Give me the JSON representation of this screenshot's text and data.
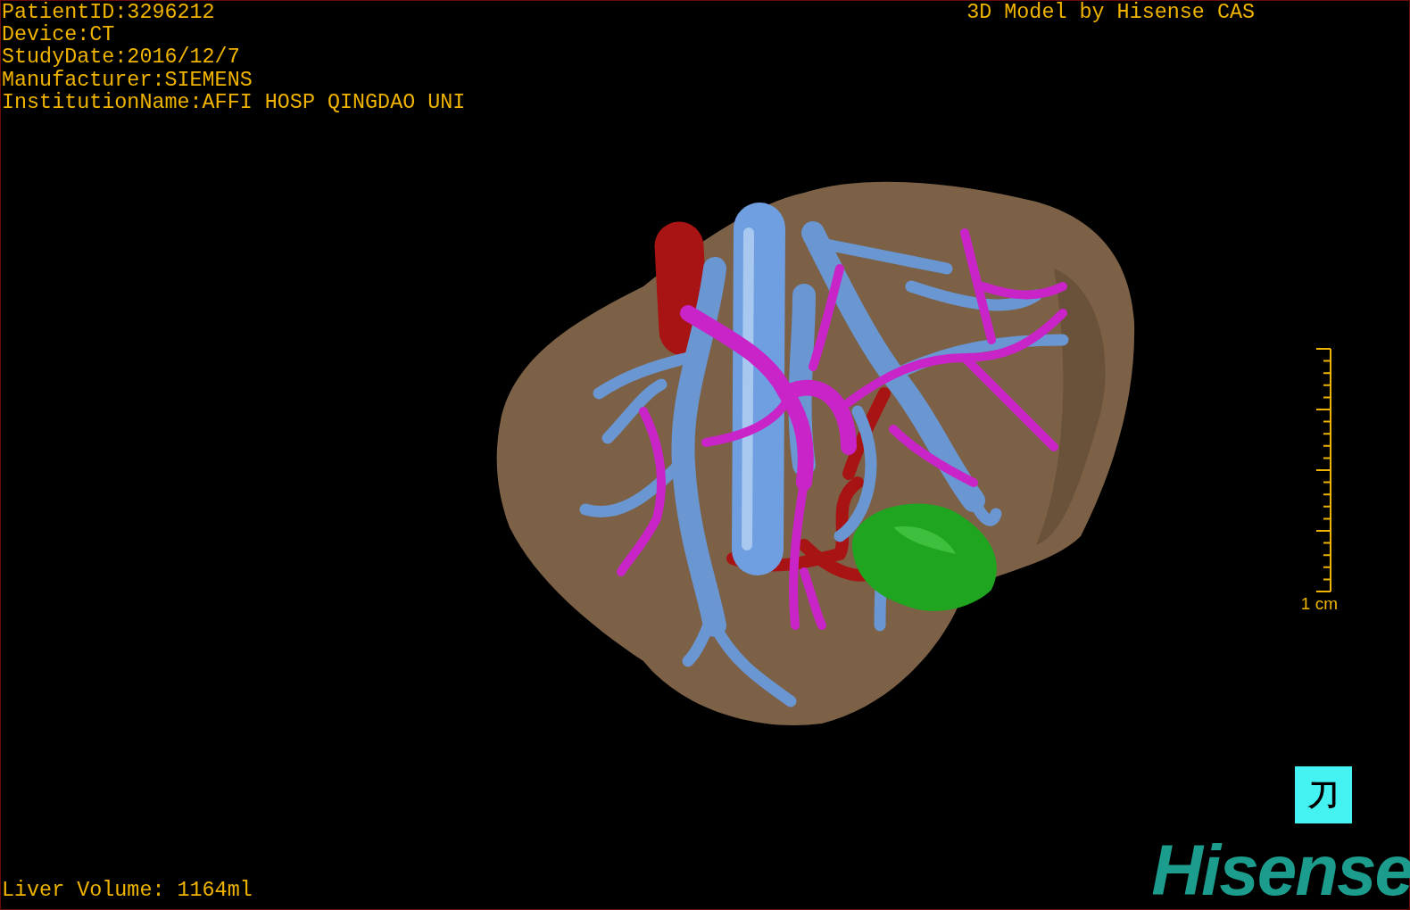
{
  "overlay": {
    "info_lines": [
      "PatientID:3296212",
      "Device:CT",
      "StudyDate:2016/12/7",
      "Manufacturer:SIEMENS",
      "InstitutionName:AFFI HOSP QINGDAO UNI"
    ],
    "title": "3D Model by Hisense CAS",
    "volume": "Liver Volume: 1164ml"
  },
  "scale_bar": {
    "label": "1 cm"
  },
  "tool_button": {
    "glyph": "刀"
  },
  "logo": "Hisense"
}
